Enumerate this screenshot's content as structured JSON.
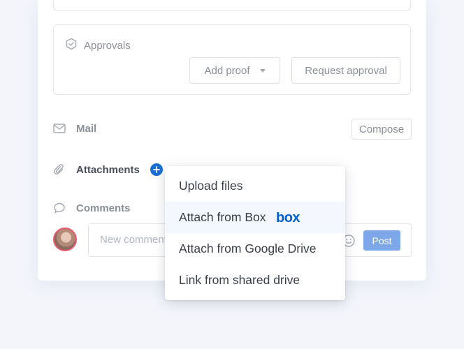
{
  "approvals": {
    "title": "Approvals",
    "add_proof_label": "Add proof",
    "request_approval_label": "Request approval"
  },
  "mail": {
    "label": "Mail",
    "compose_label": "Compose"
  },
  "attachments": {
    "label": "Attachments"
  },
  "comments": {
    "label": "Comments",
    "placeholder": "New comment",
    "post_label": "Post"
  },
  "attach_menu": {
    "items": [
      {
        "label": "Upload files"
      },
      {
        "label": "Attach from Box",
        "logo_text": "box"
      },
      {
        "label": "Attach from Google Drive"
      },
      {
        "label": "Link from shared drive"
      }
    ]
  },
  "colors": {
    "accent": "#1a6fd6",
    "post_button": "#7ea7ea",
    "box_brand": "#0061d5",
    "avatar_ring": "#e85a6a"
  }
}
